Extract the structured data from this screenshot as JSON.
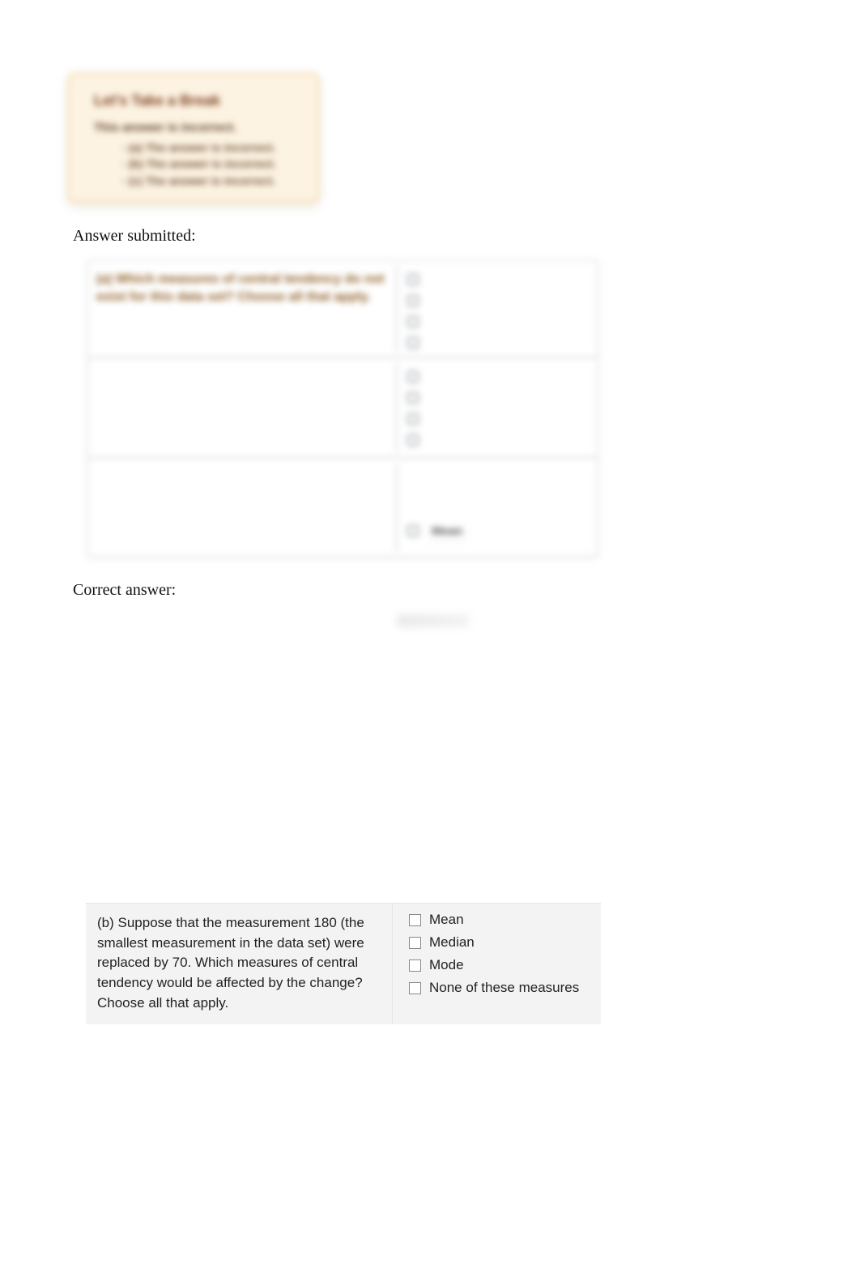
{
  "break_card": {
    "title": "Let's Take a Break",
    "subtitle": "This answer is incorrect.",
    "items": [
      "(a) The answer is incorrect.",
      "(b) The answer is incorrect.",
      "(c) The answer is incorrect."
    ]
  },
  "labels": {
    "answer_submitted": "Answer submitted:",
    "correct_answer": "Correct answer:"
  },
  "submitted_table": {
    "row1": {
      "question": "(a) Which measures of central tendency do not exist for this data set? Choose all that apply.",
      "opts": [
        "",
        "",
        "",
        ""
      ]
    },
    "row2": {
      "question": "",
      "opts": [
        "",
        "",
        "",
        ""
      ]
    },
    "row3": {
      "question": "",
      "chip": "Mean"
    }
  },
  "question_b": {
    "text": "(b) Suppose that the measurement 180 (the smallest measurement in the data set) were replaced by 70. Which measures of central tendency would be affected by the change? Choose all that apply.",
    "options": [
      "Mean",
      "Median",
      "Mode",
      "None of these measures"
    ]
  }
}
